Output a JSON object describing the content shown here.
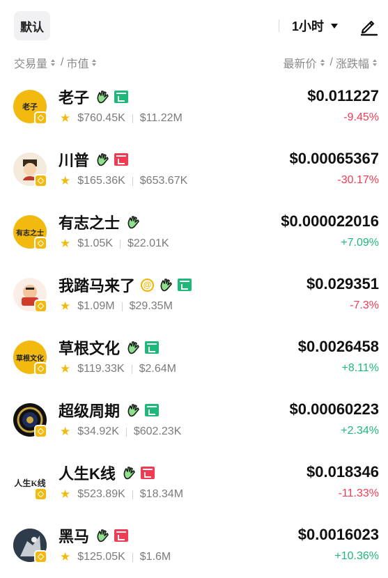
{
  "header": {
    "default_label": "默认",
    "timeframe_label": "1小时"
  },
  "sort": {
    "volume": "交易量",
    "market_cap": "市值",
    "latest_price": "最新价",
    "change": "涨跌幅",
    "slash": "/"
  },
  "coins": [
    {
      "name": "老子",
      "avatar_text": "老子",
      "volume": "$760.45K",
      "market_cap": "$11.22M",
      "price": "$0.011227",
      "change": "-9.45%",
      "direction": "down",
      "tags": [
        "hand-icon",
        "wallet-icon-green"
      ]
    },
    {
      "name": "川普",
      "avatar_text": "",
      "volume": "$165.36K",
      "market_cap": "$653.67K",
      "price": "$0.00065367",
      "change": "-30.17%",
      "direction": "down",
      "tags": [
        "hand-icon",
        "wallet-icon-red"
      ]
    },
    {
      "name": "有志之士",
      "avatar_text": "有志之士",
      "volume": "$1.05K",
      "market_cap": "$22.01K",
      "price": "$0.000022016",
      "change": "+7.09%",
      "direction": "up",
      "tags": [
        "hand-icon"
      ]
    },
    {
      "name": "我踏马来了",
      "avatar_text": "",
      "volume": "$1.09M",
      "market_cap": "$29.35M",
      "price": "$0.029351",
      "change": "-7.3%",
      "direction": "down",
      "tags": [
        "at-icon",
        "hand-icon",
        "wallet-icon-green"
      ]
    },
    {
      "name": "草根文化",
      "avatar_text": "草根文化",
      "volume": "$119.33K",
      "market_cap": "$2.64M",
      "price": "$0.0026458",
      "change": "+8.11%",
      "direction": "up",
      "tags": [
        "hand-icon",
        "wallet-icon-green"
      ]
    },
    {
      "name": "超级周期",
      "avatar_text": "",
      "volume": "$34.92K",
      "market_cap": "$602.23K",
      "price": "$0.00060223",
      "change": "+2.34%",
      "direction": "up",
      "tags": [
        "hand-icon",
        "wallet-icon-green"
      ]
    },
    {
      "name": "人生K线",
      "avatar_text": "人生K线",
      "volume": "$523.89K",
      "market_cap": "$18.34M",
      "price": "$0.018346",
      "change": "-11.33%",
      "direction": "down",
      "tags": [
        "hand-icon",
        "wallet-icon-red"
      ]
    },
    {
      "name": "黑马",
      "avatar_text": "",
      "volume": "$125.05K",
      "market_cap": "$1.6M",
      "price": "$0.0016023",
      "change": "+10.36%",
      "direction": "up",
      "tags": [
        "hand-icon",
        "wallet-icon-red"
      ]
    }
  ],
  "colors": {
    "up": "#1eb87a",
    "down": "#f03b52",
    "star": "#f2b90f",
    "muted": "#7b7b7b"
  }
}
